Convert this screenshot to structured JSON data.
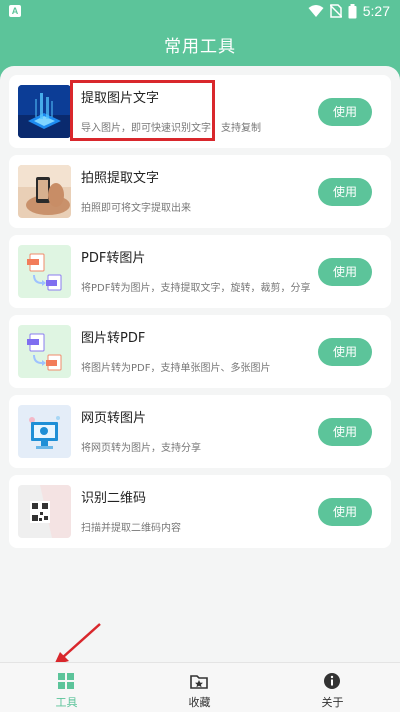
{
  "status_bar": {
    "app_badge": "A",
    "time": "5:27"
  },
  "header": {
    "title": "常用工具"
  },
  "tools": [
    {
      "title": "提取图片文字",
      "desc": "导入图片，即可快速识别文字，支持复制",
      "button": "使用"
    },
    {
      "title": "拍照提取文字",
      "desc": "拍照即可将文字提取出来",
      "button": "使用"
    },
    {
      "title": "PDF转图片",
      "desc": "将PDF转为图片，支持提取文字，旋转，裁剪，分享",
      "button": "使用"
    },
    {
      "title": "图片转PDF",
      "desc": "将图片转为PDF，支持单张图片、多张图片",
      "button": "使用"
    },
    {
      "title": "网页转图片",
      "desc": "将网页转为图片，支持分享",
      "button": "使用"
    },
    {
      "title": "识别二维码",
      "desc": "扫描并提取二维码内容",
      "button": "使用"
    }
  ],
  "thumb_icons": [
    "chip-scan-thumbnail",
    "phone-camera-thumbnail",
    "pdf-to-image-thumbnail",
    "image-to-pdf-thumbnail",
    "web-page-thumbnail",
    "qr-code-thumbnail"
  ],
  "bottom_nav": [
    {
      "label": "工具",
      "icon": "grid-icon",
      "active": true
    },
    {
      "label": "收藏",
      "icon": "star-folder-icon",
      "active": false
    },
    {
      "label": "关于",
      "icon": "info-icon",
      "active": false
    }
  ],
  "colors": {
    "accent": "#5cc49a",
    "highlight": "#d9272c"
  }
}
